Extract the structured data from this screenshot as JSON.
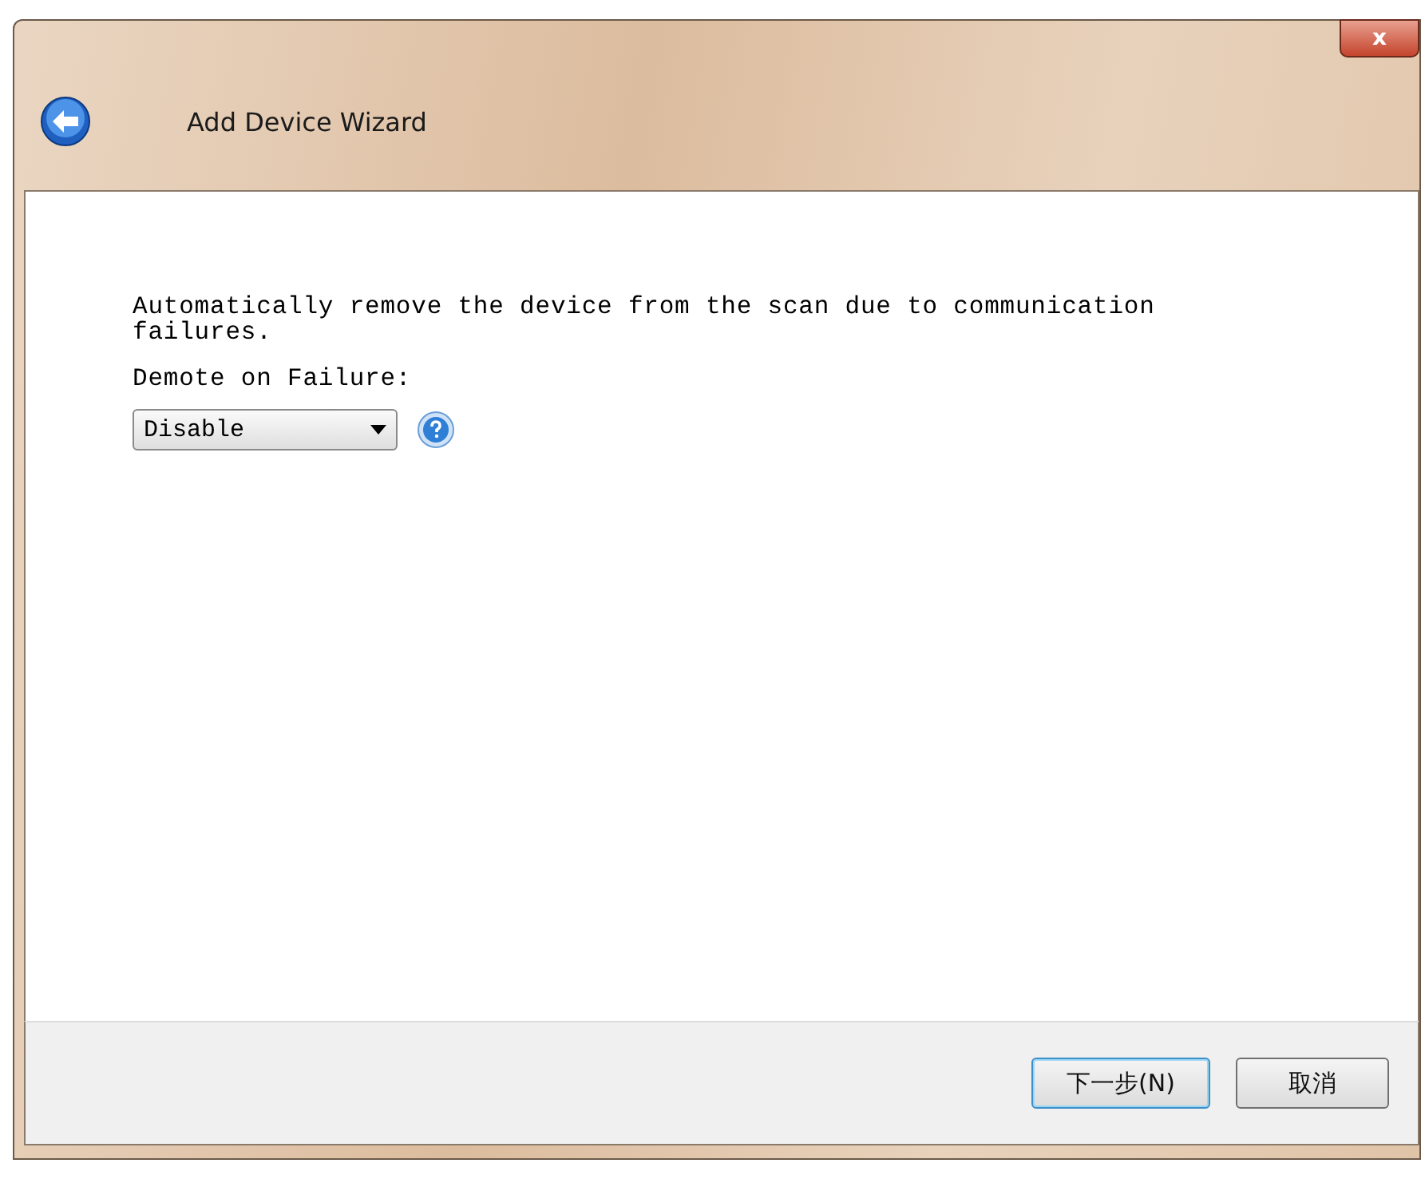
{
  "window": {
    "title": "Add Device Wizard",
    "close": "x"
  },
  "description": "Automatically remove the device from the scan due to communication failures.",
  "field": {
    "label": "Demote on Failure:",
    "value": "Disable"
  },
  "buttons": [
    {
      "label": "下一步(N)",
      "default": true
    },
    {
      "label": "取消",
      "default": false
    }
  ]
}
